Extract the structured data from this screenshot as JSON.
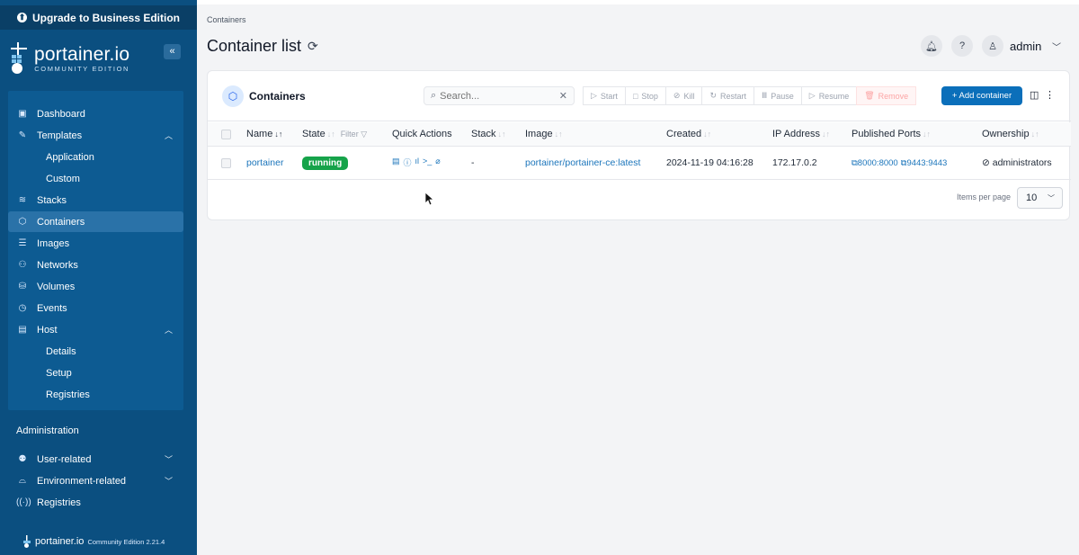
{
  "upgrade_banner": "Upgrade to Business Edition",
  "brand": {
    "name": "portainer.io",
    "edition": "COMMUNITY EDITION",
    "footer_name": "portainer.io",
    "footer_version": "Community Edition 2.21.4"
  },
  "sidebar": {
    "collapse_icon": "«",
    "items": [
      {
        "label": "Dashboard",
        "icon": "dashboard-icon"
      },
      {
        "label": "Templates",
        "icon": "edit-icon"
      },
      {
        "label": "Application"
      },
      {
        "label": "Custom"
      },
      {
        "label": "Stacks",
        "icon": "layers-icon"
      },
      {
        "label": "Containers",
        "icon": "box-icon",
        "active": true
      },
      {
        "label": "Images",
        "icon": "list-icon"
      },
      {
        "label": "Networks",
        "icon": "network-icon"
      },
      {
        "label": "Volumes",
        "icon": "database-icon"
      },
      {
        "label": "Events",
        "icon": "clock-icon"
      },
      {
        "label": "Host",
        "icon": "server-icon"
      },
      {
        "label": "Details"
      },
      {
        "label": "Setup"
      },
      {
        "label": "Registries"
      }
    ],
    "admin_title": "Administration",
    "admin_items": [
      {
        "label": "User-related"
      },
      {
        "label": "Environment-related"
      },
      {
        "label": "Registries"
      }
    ]
  },
  "header": {
    "breadcrumb": "Containers",
    "title": "Container list",
    "user": "admin"
  },
  "card": {
    "title": "Containers",
    "search_placeholder": "Search...",
    "actions": [
      "Start",
      "Stop",
      "Kill",
      "Restart",
      "Pause",
      "Resume",
      "Remove"
    ],
    "add_button": "+ Add container"
  },
  "table": {
    "columns": [
      "Name",
      "State",
      "Filter",
      "Quick Actions",
      "Stack",
      "Image",
      "Created",
      "IP Address",
      "Published Ports",
      "Ownership"
    ],
    "rows": [
      {
        "name": "portainer",
        "state": "running",
        "stack": "-",
        "image": "portainer/portainer-ce:latest",
        "created": "2024-11-19 04:16:28",
        "ip": "172.17.0.2",
        "ports": [
          "8000:8000",
          "9443:9443"
        ],
        "ownership": "administrators"
      }
    ]
  },
  "pagination": {
    "label": "Items per page",
    "value": "10"
  },
  "colors": {
    "sidebar": "#0b4f80",
    "accent": "#0b6fba",
    "running": "#16a34a"
  }
}
